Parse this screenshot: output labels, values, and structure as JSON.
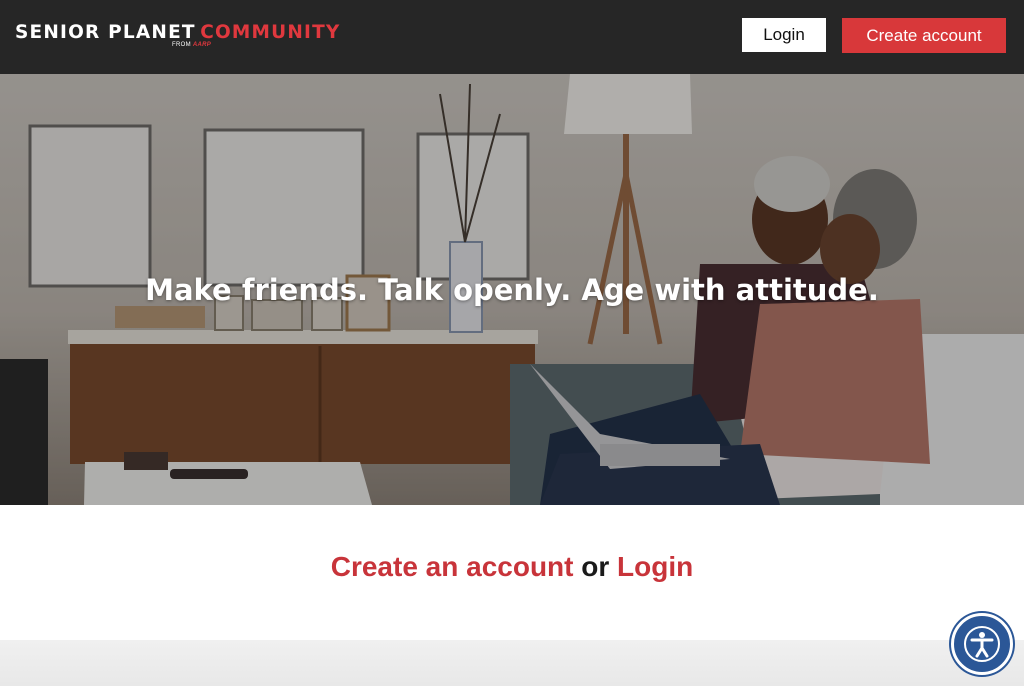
{
  "header": {
    "logo": {
      "part1": "SENIOR PLANET",
      "part2": "COMMUNITY",
      "from": "FROM",
      "aarp": "AARP"
    },
    "login_label": "Login",
    "create_account_label": "Create account"
  },
  "hero": {
    "tagline": "Make friends. Talk openly. Age with attitude."
  },
  "cta": {
    "create_label": "Create an account",
    "or_label": "or",
    "login_label": "Login"
  },
  "accessibility": {
    "icon": "accessibility-icon"
  },
  "colors": {
    "header_bg": "#262626",
    "brand_red": "#d8383a",
    "link_red": "#c8343a",
    "a11y_blue": "#2b5797"
  }
}
